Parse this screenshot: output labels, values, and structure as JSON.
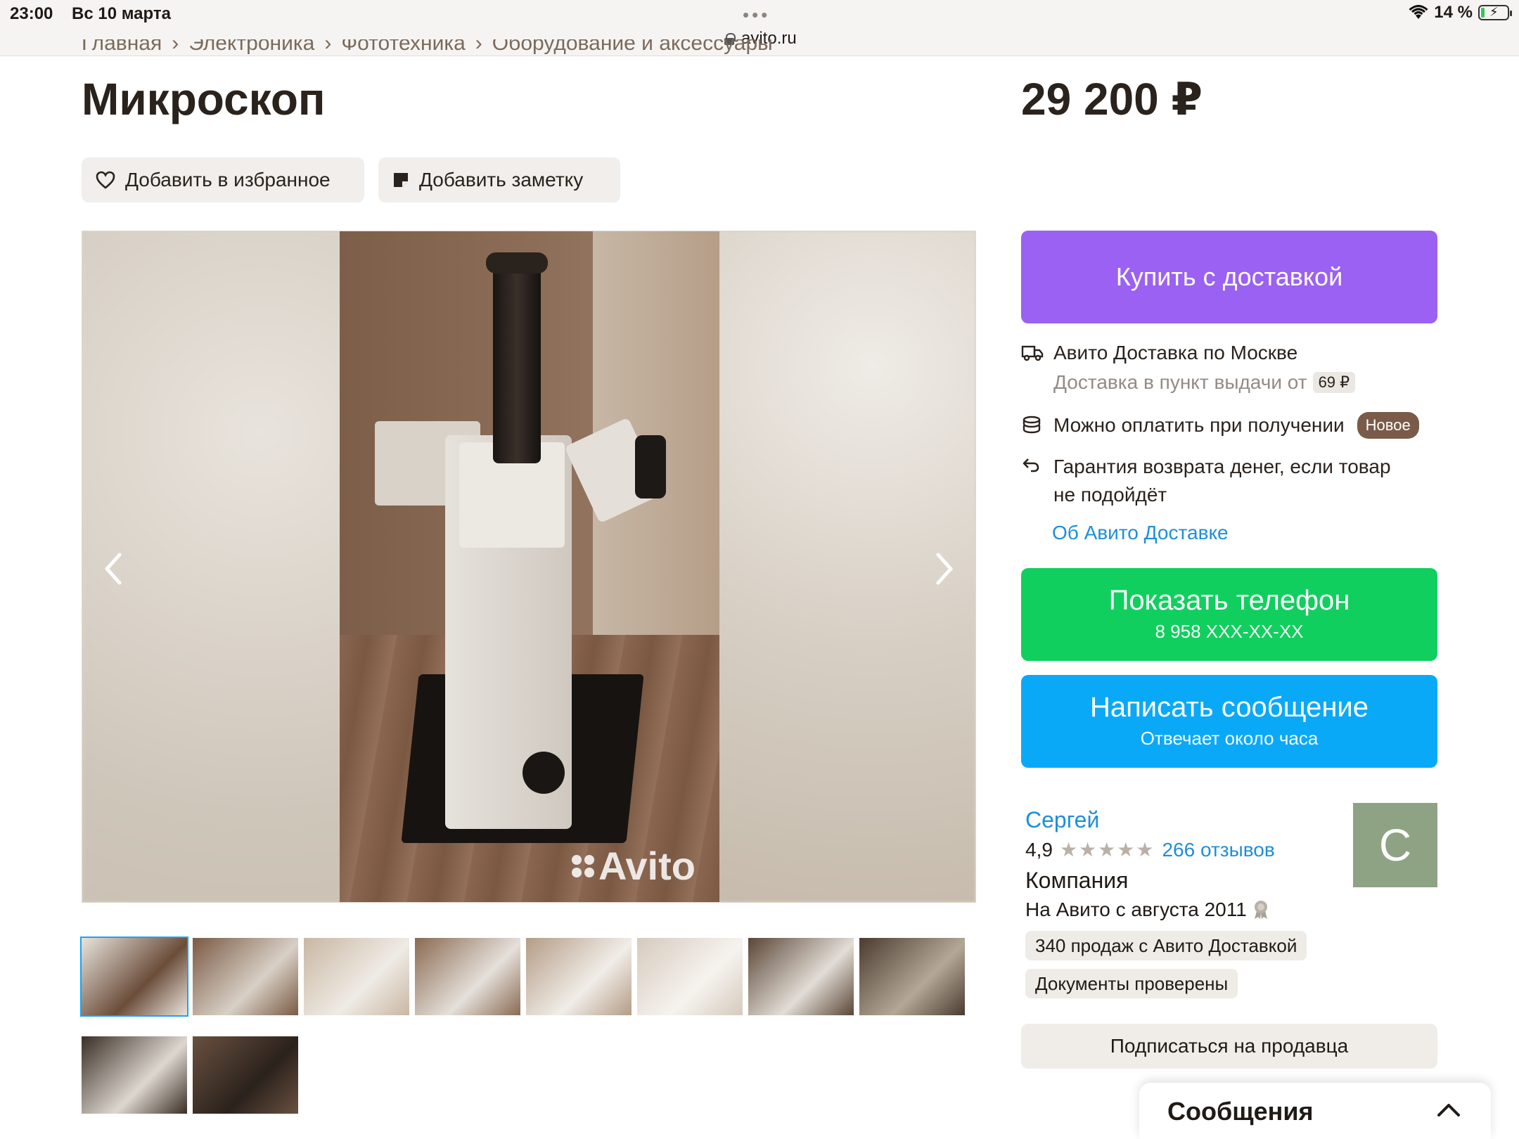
{
  "status_bar": {
    "time": "23:00",
    "date": "Вс 10 марта",
    "dots": "•••",
    "url": "avito.ru",
    "battery_text": "14 %",
    "battery_level": 0.14
  },
  "breadcrumb": [
    "Главная",
    "Электроника",
    "Фототехника",
    "Оборудование и аксессуары"
  ],
  "listing": {
    "title": "Микроскоп",
    "price": "29 200 ₽",
    "favorite_label": "Добавить в избранное",
    "note_label": "Добавить заметку"
  },
  "gallery": {
    "watermark": "Avito",
    "thumbnail_count": 10,
    "active_index": 0
  },
  "sidebar": {
    "buy_label": "Купить с доставкой",
    "delivery_title": "Авито Доставка по Москве",
    "delivery_sub": "Доставка в пункт выдачи от",
    "delivery_price": "69 ₽",
    "pay_on_receipt": "Можно оплатить при получении",
    "new_badge": "Новое",
    "guarantee": "Гарантия возврата денег, если товар не подойдёт",
    "about_link": "Об Авито Доставке",
    "phone_label": "Показать телефон",
    "phone_number": "8 958 XXX-XX-XX",
    "message_label": "Написать сообщение",
    "message_sub": "Отвечает около часа"
  },
  "seller": {
    "name": "Сергей",
    "rating": "4,9",
    "stars": "★★★★★",
    "reviews": "266 отзывов",
    "type": "Компания",
    "since": "На Авито с августа 2011",
    "avatar_letter": "С",
    "tags": [
      "340 продаж с Авито Доставкой",
      "Документы проверены"
    ],
    "subscribe_label": "Подписаться на продавца"
  },
  "messages_panel": {
    "label": "Сообщения"
  },
  "colors": {
    "buy": "#9b61f2",
    "phone": "#11cf5e",
    "message": "#0aa9f8",
    "link": "#1e8fd8",
    "new_badge": "#7a5b49"
  }
}
